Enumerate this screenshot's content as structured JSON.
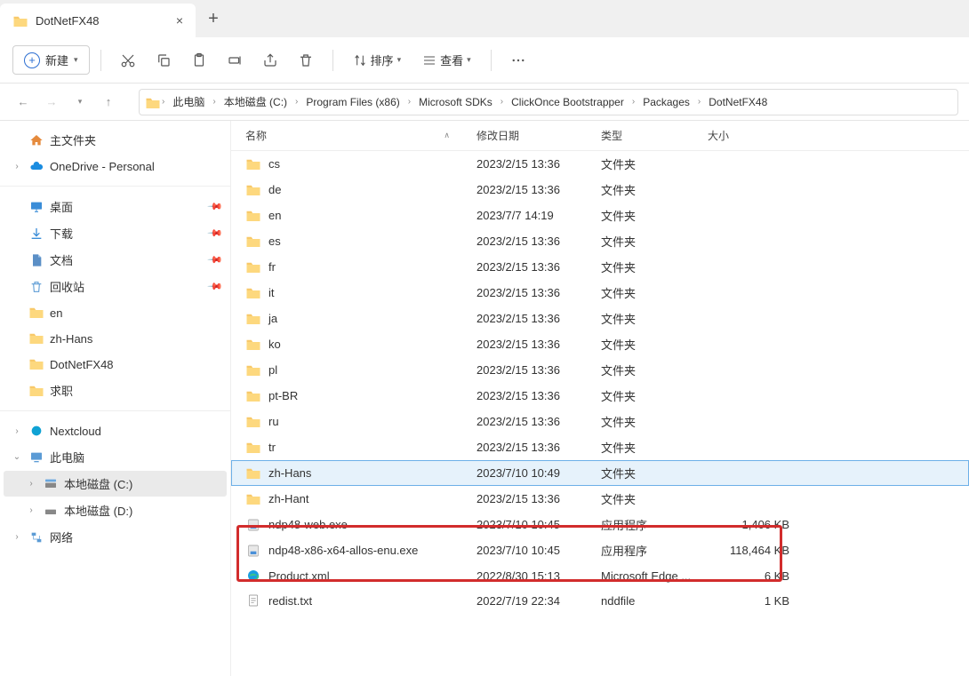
{
  "tab": {
    "title": "DotNetFX48"
  },
  "toolbar": {
    "new_label": "新建",
    "sort_label": "排序",
    "view_label": "查看"
  },
  "breadcrumb": {
    "items": [
      "此电脑",
      "本地磁盘 (C:)",
      "Program Files (x86)",
      "Microsoft SDKs",
      "ClickOnce Bootstrapper",
      "Packages",
      "DotNetFX48"
    ]
  },
  "sidebar": {
    "home": "主文件夹",
    "onedrive": "OneDrive - Personal",
    "desktop": "桌面",
    "downloads": "下载",
    "documents": "文档",
    "recycle": "回收站",
    "en": "en",
    "zhhans": "zh-Hans",
    "dotnet": "DotNetFX48",
    "qiuzhi": "求职",
    "nextcloud": "Nextcloud",
    "thispc": "此电脑",
    "cdrive": "本地磁盘 (C:)",
    "ddrive": "本地磁盘 (D:)",
    "network": "网络"
  },
  "columns": {
    "name": "名称",
    "date": "修改日期",
    "type": "类型",
    "size": "大小"
  },
  "files": [
    {
      "name": "cs",
      "date": "2023/2/15 13:36",
      "type": "文件夹",
      "size": "",
      "icon": "folder"
    },
    {
      "name": "de",
      "date": "2023/2/15 13:36",
      "type": "文件夹",
      "size": "",
      "icon": "folder"
    },
    {
      "name": "en",
      "date": "2023/7/7 14:19",
      "type": "文件夹",
      "size": "",
      "icon": "folder"
    },
    {
      "name": "es",
      "date": "2023/2/15 13:36",
      "type": "文件夹",
      "size": "",
      "icon": "folder"
    },
    {
      "name": "fr",
      "date": "2023/2/15 13:36",
      "type": "文件夹",
      "size": "",
      "icon": "folder"
    },
    {
      "name": "it",
      "date": "2023/2/15 13:36",
      "type": "文件夹",
      "size": "",
      "icon": "folder"
    },
    {
      "name": "ja",
      "date": "2023/2/15 13:36",
      "type": "文件夹",
      "size": "",
      "icon": "folder"
    },
    {
      "name": "ko",
      "date": "2023/2/15 13:36",
      "type": "文件夹",
      "size": "",
      "icon": "folder"
    },
    {
      "name": "pl",
      "date": "2023/2/15 13:36",
      "type": "文件夹",
      "size": "",
      "icon": "folder"
    },
    {
      "name": "pt-BR",
      "date": "2023/2/15 13:36",
      "type": "文件夹",
      "size": "",
      "icon": "folder"
    },
    {
      "name": "ru",
      "date": "2023/2/15 13:36",
      "type": "文件夹",
      "size": "",
      "icon": "folder"
    },
    {
      "name": "tr",
      "date": "2023/2/15 13:36",
      "type": "文件夹",
      "size": "",
      "icon": "folder"
    },
    {
      "name": "zh-Hans",
      "date": "2023/7/10 10:49",
      "type": "文件夹",
      "size": "",
      "icon": "folder",
      "selected": true
    },
    {
      "name": "zh-Hant",
      "date": "2023/2/15 13:36",
      "type": "文件夹",
      "size": "",
      "icon": "folder"
    },
    {
      "name": "ndp48-web.exe",
      "date": "2023/7/10 10:45",
      "type": "应用程序",
      "size": "1,406 KB",
      "icon": "exe"
    },
    {
      "name": "ndp48-x86-x64-allos-enu.exe",
      "date": "2023/7/10 10:45",
      "type": "应用程序",
      "size": "118,464 KB",
      "icon": "exe"
    },
    {
      "name": "Product.xml",
      "date": "2022/8/30 15:13",
      "type": "Microsoft Edge ...",
      "size": "6 KB",
      "icon": "edge"
    },
    {
      "name": "redist.txt",
      "date": "2022/7/19 22:34",
      "type": "nddfile",
      "size": "1 KB",
      "icon": "txt"
    }
  ]
}
